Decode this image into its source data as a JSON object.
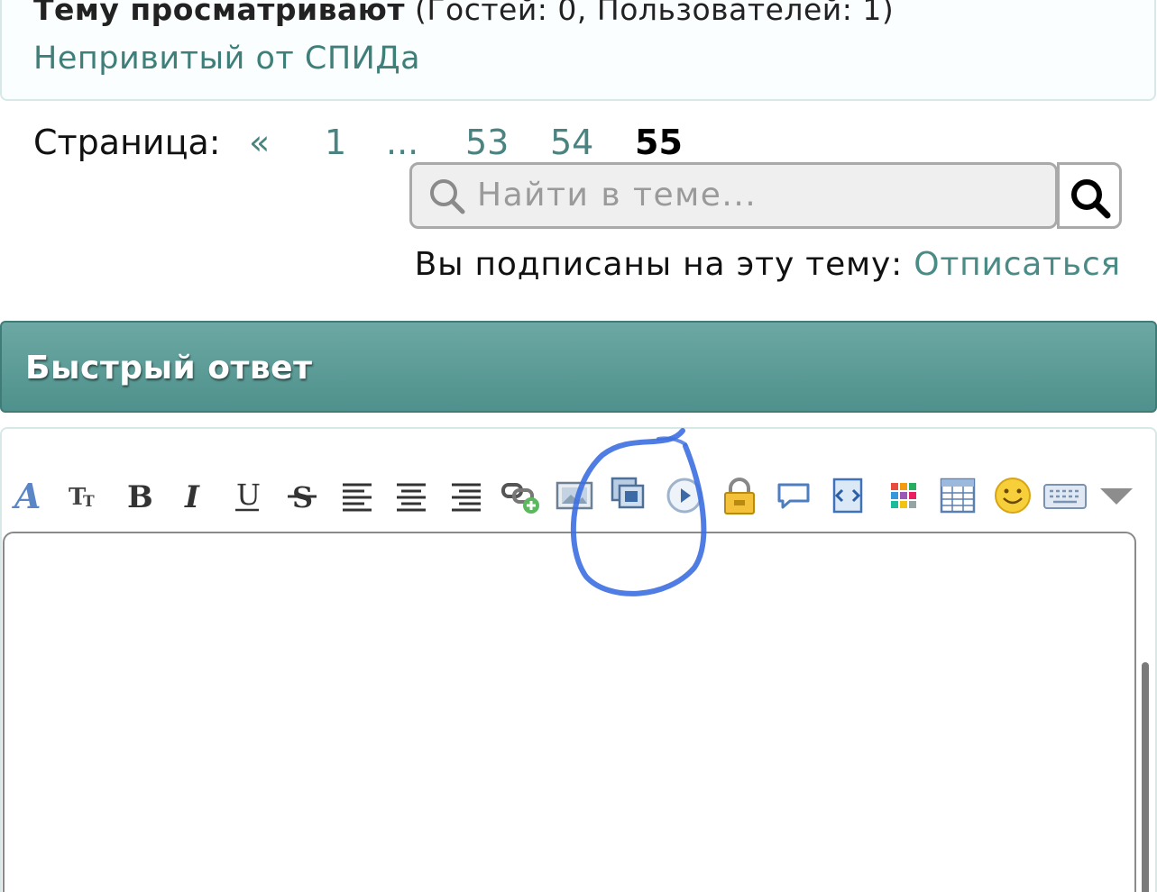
{
  "viewers": {
    "label": "Тему просматривают",
    "counts": "(Гостей: 0, Пользователей: 1)",
    "user": "Непривитый от СПИДа"
  },
  "pagination": {
    "label": "Страница:",
    "first": "«",
    "pages": [
      "1",
      "...",
      "53",
      "54"
    ],
    "current": "55"
  },
  "search": {
    "placeholder": "Найти в теме...",
    "icon": "search-icon",
    "button_icon": "search-icon"
  },
  "subscription": {
    "text": "Вы подписаны на эту тему:",
    "unsubscribe": "Отписаться"
  },
  "quick_reply": {
    "title": "Быстрый ответ",
    "toolbar_icons": [
      "font-color-icon",
      "font-size-icon",
      "bold-icon",
      "italic-icon",
      "underline-icon",
      "strikethrough-icon",
      "align-left-icon",
      "align-center-icon",
      "align-right-icon",
      "insert-link-icon",
      "insert-image-icon",
      "insert-media-icon",
      "play-icon",
      "lock-icon",
      "speech-bubble-icon",
      "code-icon",
      "color-grid-icon",
      "table-icon",
      "smiley-icon",
      "keyboard-icon",
      "dropdown-arrow-icon"
    ],
    "textarea_value": ""
  },
  "colors": {
    "accent": "#4a8380",
    "header": "#5f9f9b",
    "annotation": "#3d6fe0"
  }
}
